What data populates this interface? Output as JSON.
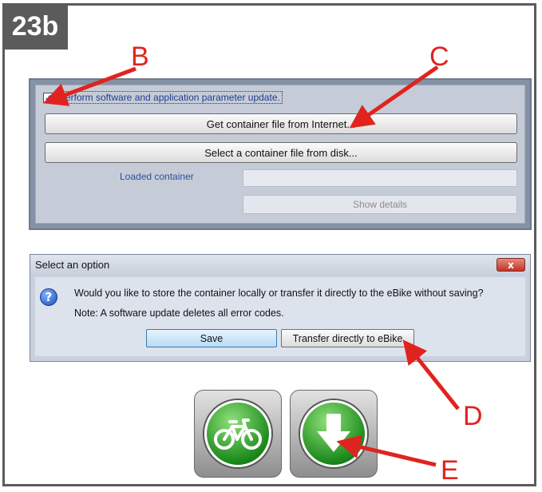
{
  "figure_label": "23b",
  "callouts": {
    "b": "B",
    "c": "C",
    "d": "D",
    "e": "E"
  },
  "update_panel": {
    "checkbox_label": "Perform software and application parameter update.",
    "checkbox_checked": true,
    "get_container_label": "Get container file from Internet...",
    "select_container_label": "Select a container file from disk...",
    "loaded_container_label": "Loaded container",
    "loaded_container_value": "",
    "show_details_label": "Show details"
  },
  "dialog": {
    "title": "Select an option",
    "close_glyph": "x",
    "icon_glyph": "?",
    "message": "Would you like to store the container locally or transfer it directly to the eBike without saving?",
    "note": "Note: A software update deletes all error codes.",
    "save_label": "Save",
    "transfer_label": "Transfer directly to eBike"
  },
  "colors": {
    "annotation": "#e0231e",
    "frame": "#5b5b5b",
    "panel": "#8592a6"
  },
  "icons": [
    "bike-icon",
    "download-arrow-icon",
    "question-icon",
    "close-icon",
    "checkmark-icon"
  ]
}
